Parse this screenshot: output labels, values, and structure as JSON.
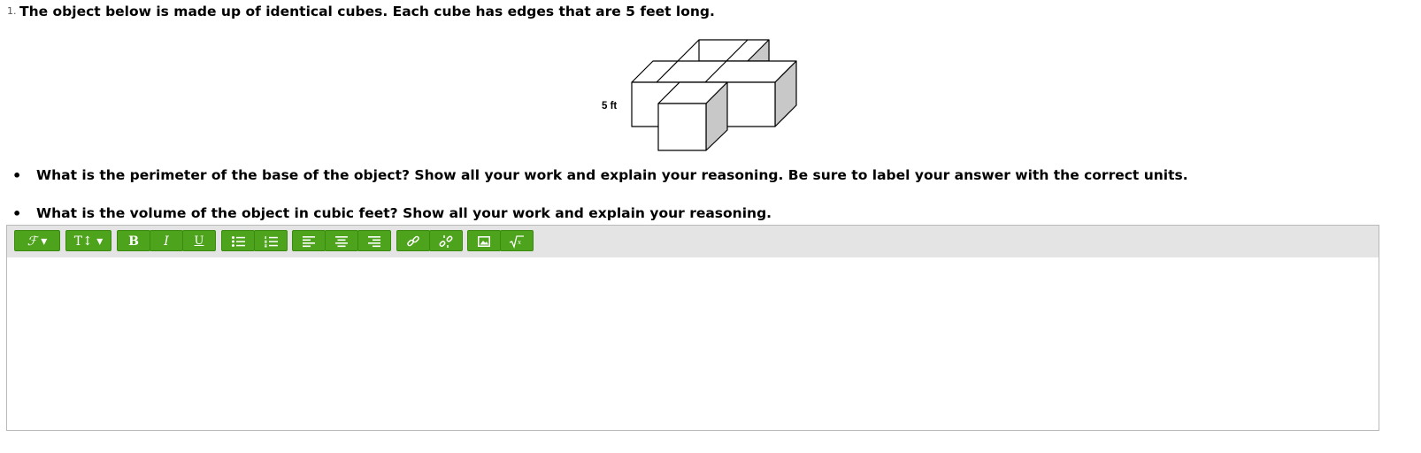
{
  "question": {
    "number": "1.",
    "stem": "The object below is made up of identical cubes. Each cube has edges that are 5 feet long.",
    "figure_label": "5 ft",
    "bullets": [
      "What is the perimeter of the base of the object? Show all your work and explain your reasoning. Be sure to label your answer with the correct units.",
      "What is the volume of the object in cubic feet? Show all your work and explain your reasoning."
    ]
  },
  "editor": {
    "accent_color": "#4ea31c",
    "toolbar_background": "#e4e4e4",
    "toolbar": {
      "font_label": "ℱ ▾",
      "size_label": "T↕ ▾",
      "bold_label": "B",
      "italic_label": "I",
      "underline_label": "U"
    },
    "icons": [
      "font-family-icon",
      "font-size-icon",
      "bold-icon",
      "italic-icon",
      "underline-icon",
      "bullet-list-icon",
      "numbered-list-icon",
      "align-left-icon",
      "align-center-icon",
      "align-right-icon",
      "link-icon",
      "unlink-icon",
      "image-icon",
      "equation-icon"
    ],
    "content": ""
  }
}
